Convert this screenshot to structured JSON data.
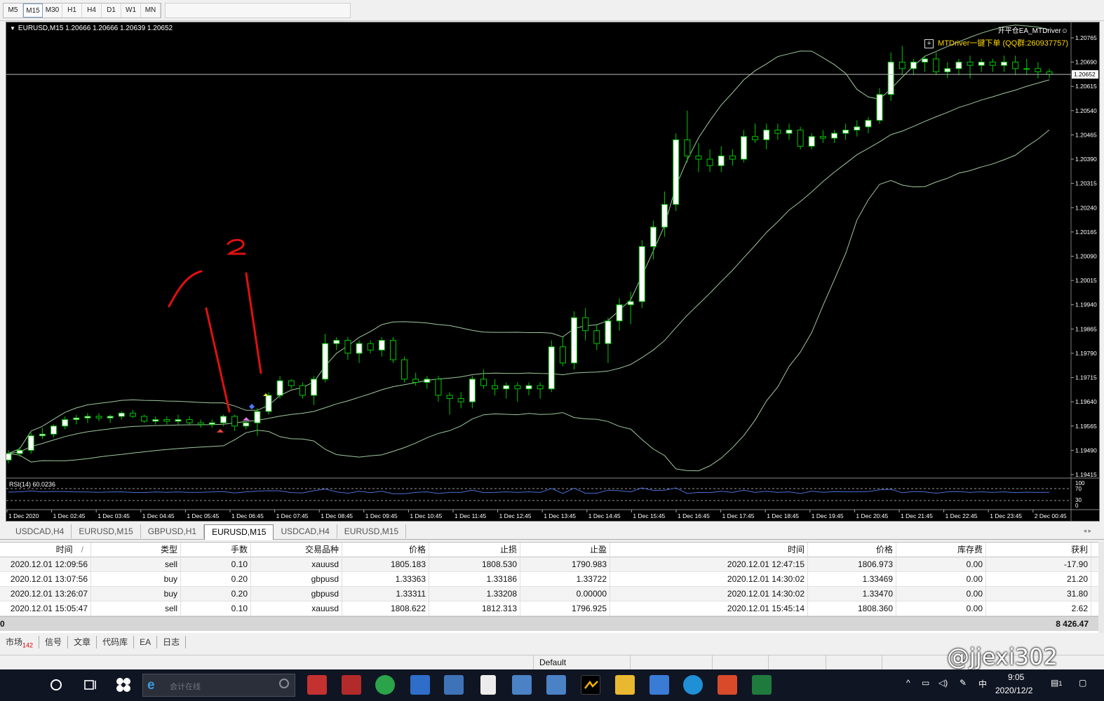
{
  "toolbar": {
    "timeframes": [
      "M5",
      "M15",
      "M30",
      "H1",
      "H4",
      "D1",
      "W1",
      "MN"
    ],
    "active": "M15"
  },
  "chart": {
    "symbol_line": "EURUSD,M15  1.20666 1.20666 1.20639 1.20652",
    "ea_title": "开平仓EA_MTDriver☺",
    "ea_label": "MTDriver一键下单 (QQ群:260937757)",
    "current_price": "1.20652",
    "rsi_label": "RSI(14) 60.0236",
    "rsi_levels": [
      "100",
      "70",
      "30",
      "0"
    ],
    "colors": {
      "bull": "#ffffff",
      "wick": "#00c800",
      "band": "#9ec89e",
      "annotation": "#e01010",
      "rsi": "#4a6fd8"
    }
  },
  "chart_data": {
    "type": "candlestick",
    "symbol": "EURUSD",
    "timeframe": "M15",
    "y_ticks": [
      "1.20765",
      "1.20690",
      "1.20615",
      "1.20540",
      "1.20465",
      "1.20390",
      "1.20315",
      "1.20240",
      "1.20165",
      "1.20090",
      "1.20015",
      "1.19940",
      "1.19865",
      "1.19790",
      "1.19715",
      "1.19640",
      "1.19565",
      "1.19490",
      "1.19415"
    ],
    "ylim": [
      1.19415,
      1.20765
    ],
    "x_ticks": [
      "1 Dec 2020",
      "1 Dec 02:45",
      "1 Dec 03:45",
      "1 Dec 04:45",
      "1 Dec 05:45",
      "1 Dec 06:45",
      "1 Dec 07:45",
      "1 Dec 08:45",
      "1 Dec 09:45",
      "1 Dec 10:45",
      "1 Dec 11:45",
      "1 Dec 12:45",
      "1 Dec 13:45",
      "1 Dec 14:45",
      "1 Dec 15:45",
      "1 Dec 16:45",
      "1 Dec 17:45",
      "1 Dec 18:45",
      "1 Dec 19:45",
      "1 Dec 20:45",
      "1 Dec 21:45",
      "1 Dec 22:45",
      "1 Dec 23:45",
      "2 Dec 00:45"
    ],
    "candles": [
      [
        1.1946,
        1.1949,
        1.1945,
        1.1948
      ],
      [
        1.1948,
        1.195,
        1.1947,
        1.1949
      ],
      [
        1.1949,
        1.19545,
        1.1948,
        1.19535
      ],
      [
        1.19535,
        1.1956,
        1.19525,
        1.1954
      ],
      [
        1.1954,
        1.1957,
        1.1953,
        1.19565
      ],
      [
        1.19565,
        1.19595,
        1.19555,
        1.19585
      ],
      [
        1.19585,
        1.196,
        1.1957,
        1.1959
      ],
      [
        1.1959,
        1.19605,
        1.19575,
        1.19595
      ],
      [
        1.19595,
        1.19605,
        1.1958,
        1.1959
      ],
      [
        1.1959,
        1.196,
        1.19575,
        1.19595
      ],
      [
        1.19595,
        1.1961,
        1.19585,
        1.19605
      ],
      [
        1.19605,
        1.19615,
        1.1959,
        1.19595
      ],
      [
        1.19595,
        1.196,
        1.19575,
        1.1958
      ],
      [
        1.1958,
        1.19595,
        1.1957,
        1.19585
      ],
      [
        1.19585,
        1.19595,
        1.1957,
        1.1958
      ],
      [
        1.1958,
        1.196,
        1.1957,
        1.19585
      ],
      [
        1.19585,
        1.19595,
        1.1957,
        1.19575
      ],
      [
        1.19575,
        1.19585,
        1.1956,
        1.1957
      ],
      [
        1.1957,
        1.19585,
        1.1956,
        1.19575
      ],
      [
        1.19575,
        1.196,
        1.19565,
        1.19595
      ],
      [
        1.19595,
        1.196,
        1.1955,
        1.19565
      ],
      [
        1.19565,
        1.1958,
        1.19555,
        1.19575
      ],
      [
        1.19575,
        1.1962,
        1.19535,
        1.1961
      ],
      [
        1.1961,
        1.1967,
        1.196,
        1.1966
      ],
      [
        1.1966,
        1.1972,
        1.1965,
        1.19705
      ],
      [
        1.19705,
        1.1971,
        1.1968,
        1.1969
      ],
      [
        1.1969,
        1.197,
        1.1965,
        1.1966
      ],
      [
        1.1966,
        1.1972,
        1.1963,
        1.1971
      ],
      [
        1.1971,
        1.1985,
        1.197,
        1.1982
      ],
      [
        1.1982,
        1.1984,
        1.198,
        1.1983
      ],
      [
        1.1983,
        1.1984,
        1.1977,
        1.1979
      ],
      [
        1.1979,
        1.1983,
        1.1976,
        1.1982
      ],
      [
        1.1982,
        1.1983,
        1.1979,
        1.198
      ],
      [
        1.198,
        1.1984,
        1.1978,
        1.1983
      ],
      [
        1.1983,
        1.1984,
        1.1976,
        1.1977
      ],
      [
        1.1977,
        1.1978,
        1.197,
        1.1971
      ],
      [
        1.1971,
        1.1973,
        1.1969,
        1.197
      ],
      [
        1.197,
        1.1972,
        1.1968,
        1.1971
      ],
      [
        1.1971,
        1.1972,
        1.1964,
        1.1966
      ],
      [
        1.1966,
        1.1967,
        1.196,
        1.1965
      ],
      [
        1.1965,
        1.1967,
        1.1962,
        1.1964
      ],
      [
        1.1964,
        1.1972,
        1.1962,
        1.1971
      ],
      [
        1.1971,
        1.1974,
        1.1968,
        1.1969
      ],
      [
        1.1969,
        1.1971,
        1.1966,
        1.1968
      ],
      [
        1.1968,
        1.197,
        1.1965,
        1.1969
      ],
      [
        1.1969,
        1.197,
        1.1964,
        1.1968
      ],
      [
        1.1968,
        1.197,
        1.1966,
        1.1969
      ],
      [
        1.1969,
        1.197,
        1.1965,
        1.1968
      ],
      [
        1.1968,
        1.1983,
        1.1967,
        1.1981
      ],
      [
        1.1981,
        1.1984,
        1.1975,
        1.1976
      ],
      [
        1.1976,
        1.1992,
        1.1974,
        1.199
      ],
      [
        1.199,
        1.1993,
        1.1983,
        1.1986
      ],
      [
        1.1986,
        1.1988,
        1.198,
        1.1982
      ],
      [
        1.1982,
        1.199,
        1.1976,
        1.1989
      ],
      [
        1.1989,
        1.1996,
        1.1986,
        1.1994
      ],
      [
        1.1994,
        1.1998,
        1.1988,
        1.1995
      ],
      [
        1.1995,
        1.2014,
        1.1993,
        1.2012
      ],
      [
        1.2012,
        1.202,
        1.2008,
        1.2018
      ],
      [
        1.2018,
        1.2029,
        1.2015,
        1.2025
      ],
      [
        1.2025,
        1.2047,
        1.2023,
        1.2045
      ],
      [
        1.2045,
        1.2054,
        1.2038,
        1.204
      ],
      [
        1.204,
        1.2044,
        1.2035,
        1.2039
      ],
      [
        1.2039,
        1.2042,
        1.2035,
        1.2037
      ],
      [
        1.2037,
        1.2043,
        1.2035,
        1.204
      ],
      [
        1.204,
        1.2042,
        1.2037,
        1.2039
      ],
      [
        1.2039,
        1.2048,
        1.2038,
        1.2046
      ],
      [
        1.2046,
        1.205,
        1.2044,
        1.2045
      ],
      [
        1.2045,
        1.205,
        1.2042,
        1.2048
      ],
      [
        1.2048,
        1.205,
        1.2045,
        1.2047
      ],
      [
        1.2047,
        1.205,
        1.2045,
        1.2048
      ],
      [
        1.2048,
        1.2049,
        1.2042,
        1.2043
      ],
      [
        1.2043,
        1.2047,
        1.2042,
        1.2046
      ],
      [
        1.2046,
        1.2048,
        1.2044,
        1.20455
      ],
      [
        1.20455,
        1.2048,
        1.2044,
        1.2047
      ],
      [
        1.2047,
        1.205,
        1.2045,
        1.2048
      ],
      [
        1.2048,
        1.2051,
        1.2046,
        1.2049
      ],
      [
        1.2049,
        1.2052,
        1.2047,
        1.2051
      ],
      [
        1.2051,
        1.2061,
        1.205,
        1.2059
      ],
      [
        1.2059,
        1.2072,
        1.2057,
        1.2069
      ],
      [
        1.2069,
        1.2074,
        1.2065,
        1.2067
      ],
      [
        1.2067,
        1.207,
        1.2065,
        1.2069
      ],
      [
        1.2069,
        1.2071,
        1.2066,
        1.207
      ],
      [
        1.207,
        1.2072,
        1.2065,
        1.2066
      ],
      [
        1.2066,
        1.2069,
        1.2064,
        1.2067
      ],
      [
        1.2067,
        1.207,
        1.2065,
        1.2069
      ],
      [
        1.2069,
        1.2071,
        1.2064,
        1.2068
      ],
      [
        1.2068,
        1.207,
        1.2066,
        1.2069
      ],
      [
        1.2069,
        1.207,
        1.2066,
        1.2068
      ],
      [
        1.2068,
        1.2071,
        1.2066,
        1.2069
      ],
      [
        1.2069,
        1.2071,
        1.2065,
        1.2067
      ],
      [
        1.2067,
        1.207,
        1.2065,
        1.2067
      ],
      [
        1.2067,
        1.2069,
        1.2064,
        1.2066
      ],
      [
        1.2066,
        1.2067,
        1.2064,
        1.20652
      ]
    ]
  },
  "chart_tabs": [
    "USDCAD,H4",
    "EURUSD,M15",
    "GBPUSD,H1",
    "EURUSD,M15",
    "USDCAD,H4",
    "EURUSD,M15"
  ],
  "chart_tabs_active": 3,
  "history": {
    "headers": [
      "时间",
      "类型",
      "手数",
      "交易品种",
      "价格",
      "止损",
      "止盈",
      "时间",
      "价格",
      "库存费",
      "获利"
    ],
    "sort_mark": "/",
    "rows": [
      [
        "2020.12.01 12:09:56",
        "sell",
        "0.10",
        "xauusd",
        "1805.183",
        "1808.530",
        "1790.983",
        "2020.12.01 12:47:15",
        "1806.973",
        "0.00",
        "-17.90"
      ],
      [
        "2020.12.01 13:07:56",
        "buy",
        "0.20",
        "gbpusd",
        "1.33363",
        "1.33186",
        "1.33722",
        "2020.12.01 14:30:02",
        "1.33469",
        "0.00",
        "21.20"
      ],
      [
        "2020.12.01 13:26:07",
        "buy",
        "0.20",
        "gbpusd",
        "1.33311",
        "1.33208",
        "0.00000",
        "2020.12.01 14:30:02",
        "1.33470",
        "0.00",
        "31.80"
      ],
      [
        "2020.12.01 15:05:47",
        "sell",
        "0.10",
        "xauusd",
        "1808.622",
        "1812.313",
        "1796.925",
        "2020.12.01 15:45:14",
        "1808.360",
        "0.00",
        "2.62"
      ]
    ],
    "footer_left": "0",
    "footer_total": "8 426.47"
  },
  "bottom_tabs": [
    {
      "label": "市场",
      "badge": "142"
    },
    {
      "label": "信号"
    },
    {
      "label": "文章"
    },
    {
      "label": "代码库"
    },
    {
      "label": "EA"
    },
    {
      "label": "日志"
    }
  ],
  "status": {
    "profile": "Default"
  },
  "taskbar": {
    "search_placeholder": "会计在线",
    "time": "9:05",
    "date": "2020/12/2",
    "ime": "中",
    "notification_count": "1"
  },
  "watermark": "@jjexi302"
}
